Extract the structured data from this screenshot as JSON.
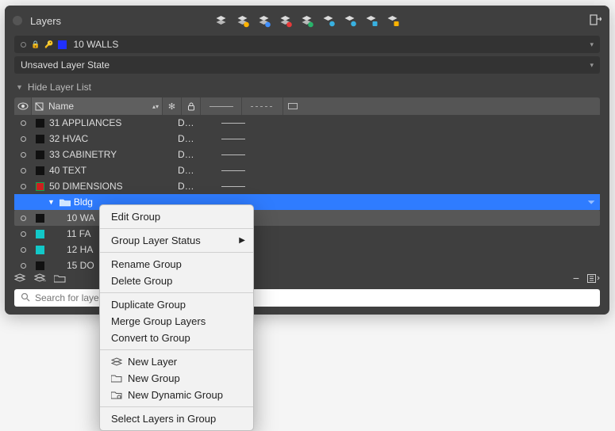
{
  "title": "Layers",
  "toolbar_icons": [
    "layers-icon",
    "layers-add-icon",
    "layers-dup-icon",
    "layers-del-icon",
    "layers-filter-icon",
    "layers-snow-icon",
    "layers-key-icon",
    "layers-lock-icon",
    "layers-folder-icon"
  ],
  "current_layer": {
    "name": "10 WALLS",
    "swatch": "#2030ff"
  },
  "state_label": "Unsaved Layer State",
  "toggle_label": "Hide Layer List",
  "columns": {
    "name": "Name"
  },
  "layers": [
    {
      "name": "31 APPLIANCES",
      "desc": "D…",
      "swatch": "#111111"
    },
    {
      "name": "32 HVAC",
      "desc": "D…",
      "swatch": "#111111"
    },
    {
      "name": "33 CABINETRY",
      "desc": "D…",
      "swatch": "#111111"
    },
    {
      "name": "40 TEXT",
      "desc": "D…",
      "swatch": "#111111"
    },
    {
      "name": "50 DIMENSIONS",
      "desc": "D…",
      "swatch": "#cc2020"
    }
  ],
  "group": {
    "name": "Bldg",
    "swatch": "#0aa84f"
  },
  "children": [
    {
      "name": "10 WA",
      "swatch": "#111111",
      "highlight": true
    },
    {
      "name": "11 FA",
      "swatch": "#12c8c8"
    },
    {
      "name": "12 HA",
      "swatch": "#12c8c8"
    },
    {
      "name": "15 DO",
      "swatch": "#111111"
    }
  ],
  "search_placeholder": "Search for layer",
  "context_menu": {
    "edit": "Edit Group",
    "status": "Group Layer Status",
    "rename": "Rename Group",
    "delete": "Delete Group",
    "duplicate": "Duplicate Group",
    "merge": "Merge Group Layers",
    "convert": "Convert to Group",
    "new_layer": "New Layer",
    "new_group": "New Group",
    "new_dynamic": "New Dynamic Group",
    "select": "Select Layers in Group"
  }
}
